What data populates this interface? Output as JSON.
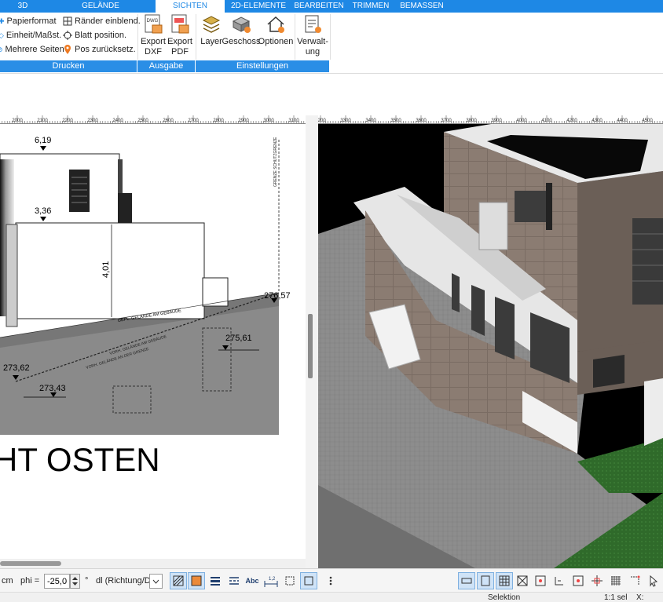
{
  "tabs": [
    "3D",
    "GELÄNDE",
    "SICHTEN",
    "2D-ELEMENTE",
    "BEARBEITEN",
    "TRIMMEN",
    "BEMASSEN"
  ],
  "active_tab": "SICHTEN",
  "ribbon": {
    "drucken": {
      "label": "Drucken",
      "items": [
        "Papierformat",
        "Einheit/Maßst.",
        "Mehrere Seiten",
        "Ränder einblend.",
        "Blatt position.",
        "Pos zurücksetz."
      ]
    },
    "ausgabe": {
      "label": "Ausgabe",
      "export_dxf": [
        "Export",
        "DXF"
      ],
      "export_pdf": [
        "Export",
        "PDF"
      ]
    },
    "einstellungen": {
      "label": "Einstellungen",
      "layer": "Layer",
      "geschoss": "Geschoss",
      "optionen": "Optionen",
      "verwaltung": [
        "Verwalt-",
        "ung"
      ]
    }
  },
  "ruler_left": [
    "2000",
    "2100",
    "2200",
    "2300",
    "2400",
    "2500",
    "2600",
    "2700",
    "2800",
    "2900",
    "3000",
    "3100"
  ],
  "ruler_right": [
    "3200",
    "3300",
    "3400",
    "3500",
    "3600",
    "3700",
    "3800",
    "3900",
    "4000",
    "4100",
    "4200",
    "4300",
    "4400",
    "4500"
  ],
  "drawing": {
    "title": "HT OSTEN",
    "dims": {
      "d1": "6,19",
      "d2": "3,36",
      "d3": "4,01",
      "d4": "276,57",
      "d5": "275,61",
      "d6": "273,62",
      "d7": "273,43"
    },
    "annotations": {
      "gepl": "GEPL. GELÄNDE AM GEBÄUDE",
      "vorh1": "VORH. GELÄNDE AM GEBÄUDE",
      "vorh2": "VORH. GELÄNDE AN DER GRENZE",
      "grenze": "GRENZE SCHUTZGRENZE"
    }
  },
  "bottom": {
    "unit": "cm",
    "phi_label": "phi =",
    "phi_value": "-25,05",
    "degree": "°",
    "dl_label": "dl (Richtung/Di",
    "abc": "Abc",
    "measure": "1,2"
  },
  "status": {
    "mode": "Selektion",
    "scale": "1:1 sel",
    "x": "X:"
  },
  "colors": {
    "accent": "#1e88e5",
    "terrain": "#888888",
    "grass": "#2f6f2a",
    "facade": "#8c7a70"
  }
}
